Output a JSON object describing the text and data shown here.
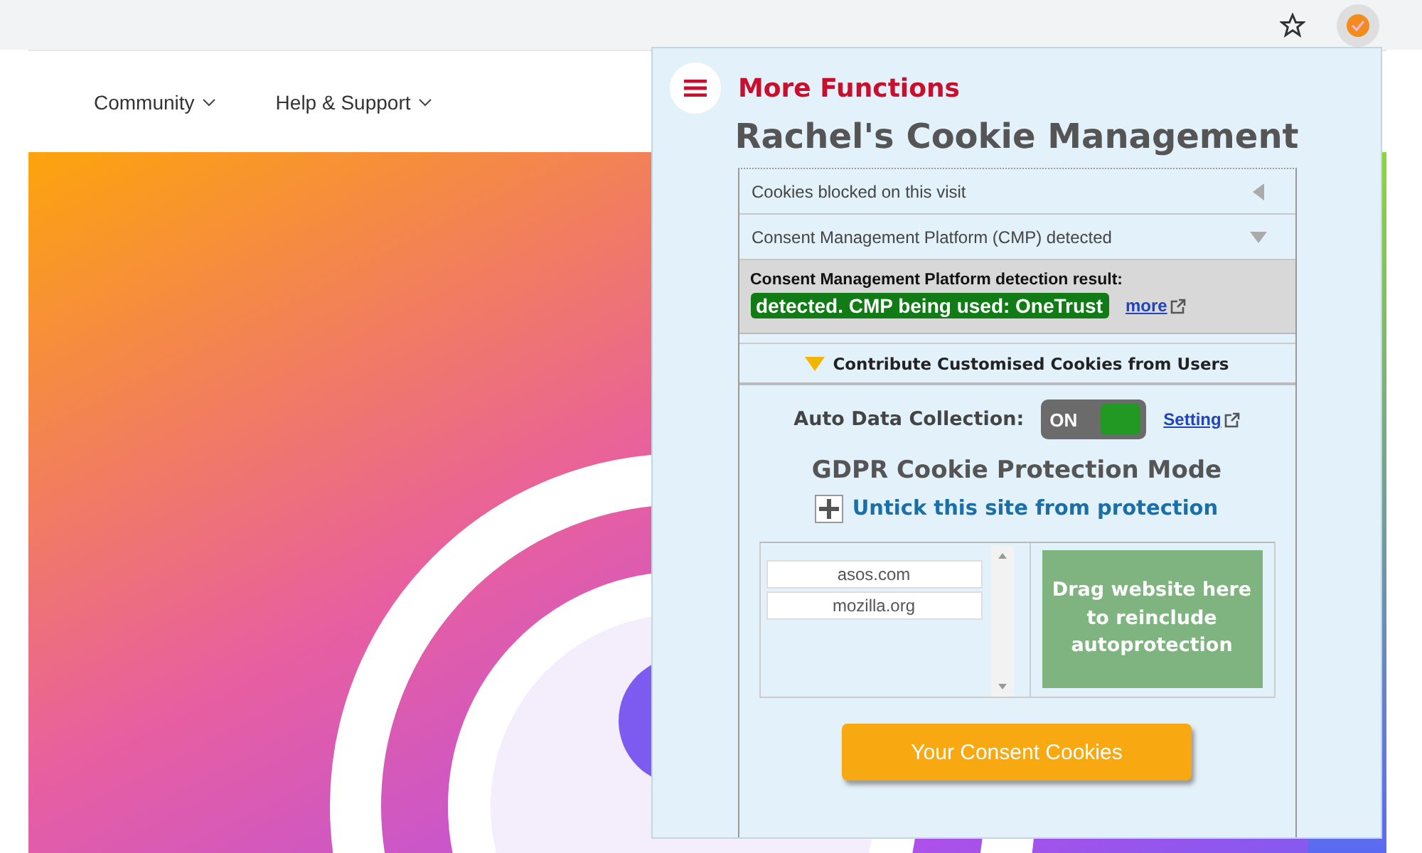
{
  "page": {
    "nav": [
      {
        "label": "Community"
      },
      {
        "label": "Help & Support"
      }
    ]
  },
  "popup": {
    "menu_label": "More Functions",
    "title": "Rachel's Cookie Management",
    "rows": [
      {
        "label": "Cookies blocked on this visit",
        "expanded": false
      },
      {
        "label": "Consent Management Platform (CMP) detected",
        "expanded": true
      }
    ],
    "detection": {
      "heading": "Consent Management Platform detection result:",
      "result": "detected. CMP being used: OneTrust",
      "link": "more"
    },
    "contribute": {
      "label": "Contribute Customised Cookies from Users",
      "expanded": true
    },
    "auto_collection": {
      "label": "Auto Data Collection:",
      "toggle": "ON",
      "on": true,
      "link": "Setting"
    },
    "protection": {
      "heading": "GDPR Cookie Protection Mode",
      "action": "Untick this site from protection"
    },
    "excluded_sites": [
      "asos.com",
      "mozilla.org"
    ],
    "drop_zone": "Drag website here to reinclude autoprotection",
    "button": "Your Consent Cookies"
  }
}
